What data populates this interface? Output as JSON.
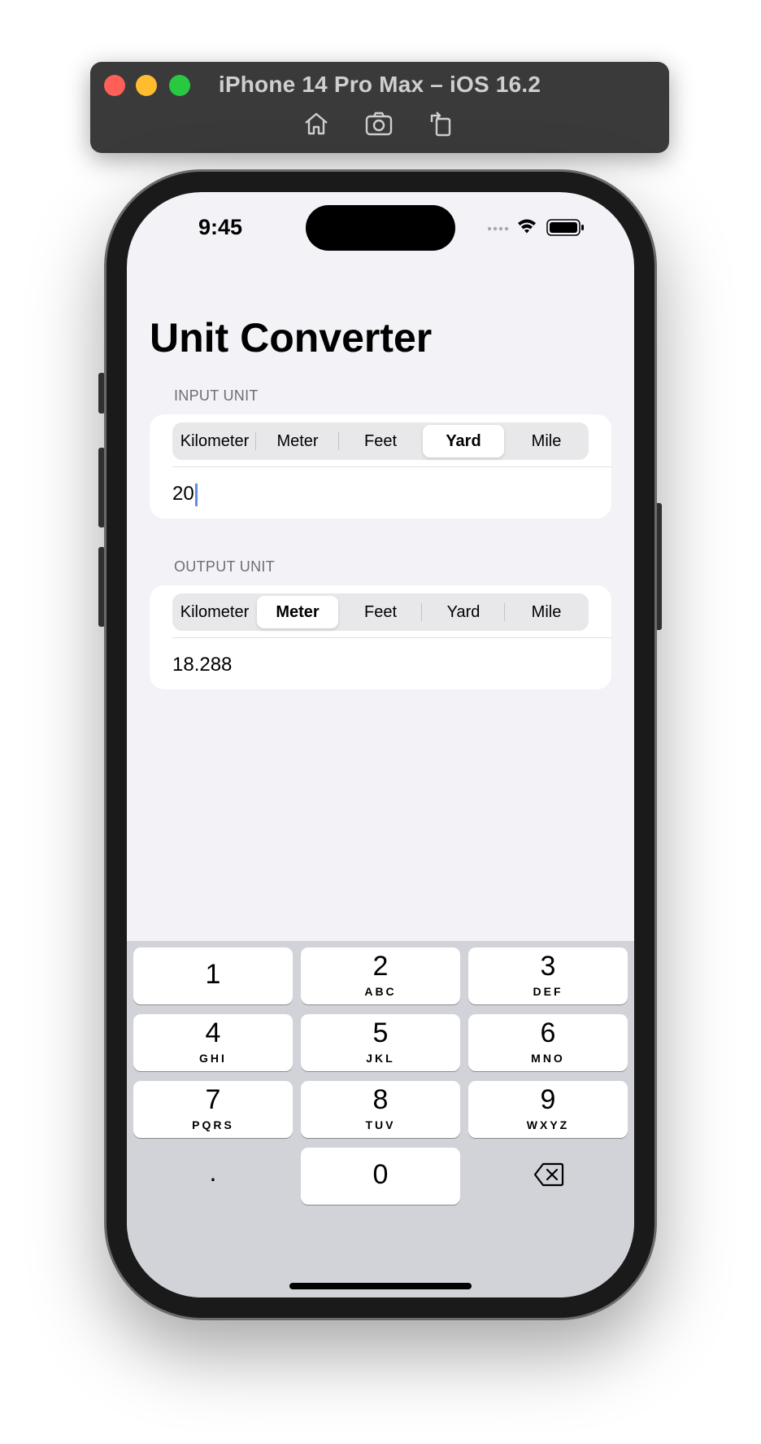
{
  "simulator": {
    "title": "iPhone 14 Pro Max – iOS 16.2",
    "tools": [
      "home-icon",
      "screenshot-icon",
      "rotate-icon"
    ]
  },
  "status_bar": {
    "time": "9:45",
    "icons": [
      "signal-dots-icon",
      "wifi-icon",
      "battery-icon"
    ]
  },
  "app": {
    "title": "Unit Converter",
    "input": {
      "header": "INPUT UNIT",
      "units": [
        "Kilometer",
        "Meter",
        "Feet",
        "Yard",
        "Mile"
      ],
      "selected": "Yard",
      "value": "20"
    },
    "output": {
      "header": "OUTPUT UNIT",
      "units": [
        "Kilometer",
        "Meter",
        "Feet",
        "Yard",
        "Mile"
      ],
      "selected": "Meter",
      "value": "18.288"
    }
  },
  "keyboard": {
    "keys": [
      {
        "num": "1",
        "letters": ""
      },
      {
        "num": "2",
        "letters": "ABC"
      },
      {
        "num": "3",
        "letters": "DEF"
      },
      {
        "num": "4",
        "letters": "GHI"
      },
      {
        "num": "5",
        "letters": "JKL"
      },
      {
        "num": "6",
        "letters": "MNO"
      },
      {
        "num": "7",
        "letters": "PQRS"
      },
      {
        "num": "8",
        "letters": "TUV"
      },
      {
        "num": "9",
        "letters": "WXYZ"
      }
    ],
    "decimal": ".",
    "zero": "0",
    "delete_icon": "delete-backspace-icon"
  },
  "colors": {
    "background": "#f2f2f7",
    "keyboard": "#d1d3d9",
    "caret": "#5e8fe0"
  }
}
